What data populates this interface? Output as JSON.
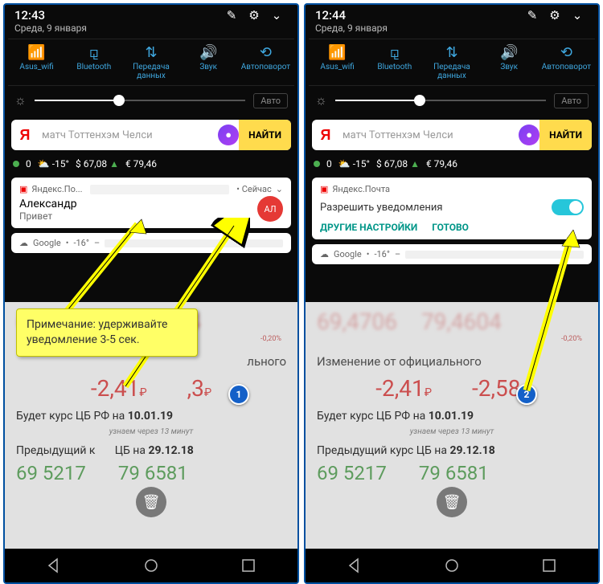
{
  "left": {
    "time": "12:43",
    "date": "Среда, 9 января",
    "search_query": "матч Тоттенхэм Челси",
    "find_label": "НАЙТИ",
    "weather": {
      "count": "0",
      "temp": "-15°",
      "usd": "$ 67,08",
      "usd_dir": "▲",
      "eur": "€ 79,46"
    },
    "notification": {
      "app": "Яндекс.По...",
      "time_label": "• Сейчас",
      "sender": "Александр",
      "preview": "Привет",
      "avatar": "АЛ"
    },
    "google": {
      "title": "Google",
      "temp": "-16°"
    },
    "callout": "Примечание: удерживайте уведомление 3-5 сек.",
    "badge": "1"
  },
  "right": {
    "time": "12:44",
    "date": "Среда, 9 января",
    "search_query": "матч Тоттенхэм Челси",
    "find_label": "НАЙТИ",
    "weather": {
      "count": "0",
      "temp": "-15°",
      "usd": "$ 67,08",
      "usd_dir": "▲",
      "eur": "€ 79,46"
    },
    "settings": {
      "app": "Яндекс.Почта",
      "allow_label": "Разрешить уведомления",
      "more": "ДРУГИЕ НАСТРОЙКИ",
      "done": "ГОТОВО"
    },
    "google": {
      "title": "Google",
      "temp": "-16°"
    },
    "badge": "2"
  },
  "quick": {
    "wifi": "Asus_wifi",
    "bt": "Bluetooth",
    "data": "Передача данных",
    "sound": "Звук",
    "rotate": "Автоповорот",
    "auto": "Авто"
  },
  "bg": {
    "big1": "69,4706",
    "big2": "79,4604",
    "change_sub": "-0,20%",
    "change_title": "Изменение от официального",
    "delta1": "-2,41",
    "delta2": "-2,58",
    "abbr": "льного",
    "future": "Будет курс ЦБ РФ на",
    "future_date": "10.01.19",
    "wait": "узнаем через 13 минут",
    "past": "Предыдущий курс ЦБ на",
    "past_short": "Предыдущий к",
    "past_short2": "ЦБ на",
    "past_date": "29.12.18",
    "bot1": "69 5217",
    "bot2": "79 6581"
  }
}
